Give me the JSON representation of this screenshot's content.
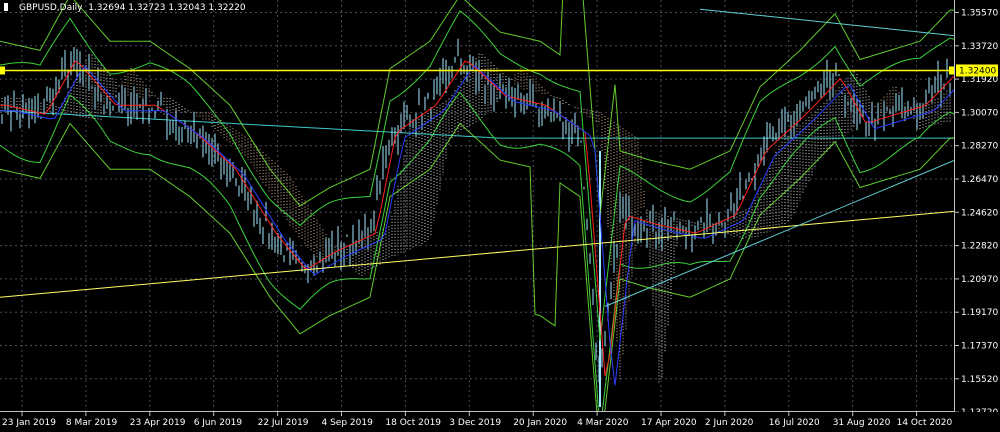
{
  "header": {
    "symbol": "GBPUSD,Daily",
    "ohlc": "1.32694 1.32723 1.32043 1.32220"
  },
  "price_scale": {
    "levels": [
      "1.35570",
      "1.33720",
      "1.31920",
      "1.30070",
      "1.28270",
      "1.26470",
      "1.24620",
      "1.22820",
      "1.20970",
      "1.19170",
      "1.17370",
      "1.15520",
      "1.13720"
    ],
    "current_price": "1.32400",
    "range": [
      1.1372,
      1.3557
    ]
  },
  "time_scale": {
    "labels": [
      "23 Jan 2019",
      "8 Mar 2019",
      "23 Apr 2019",
      "6 Jun 2019",
      "22 Jul 2019",
      "4 Sep 2019",
      "18 Oct 2019",
      "3 Dec 2019",
      "20 Jan 2020",
      "4 Mar 2020",
      "17 Apr 2020",
      "2 Jun 2020",
      "16 Jul 2020",
      "31 Aug 2020",
      "14 Oct 2020"
    ]
  },
  "colors": {
    "background": "#000000",
    "grid": "#4a4f5c",
    "axis": "#c0c0c0",
    "candle": "#9fe8ff",
    "horizontal_line": "#ffff00",
    "trend_line": "#ffff66",
    "channel_line": "#5ecfd4",
    "bollinger": "#3cd23c",
    "bollinger_outer": "#7cfc3a",
    "tenkan": "#ff2020",
    "kijun": "#2a3cff",
    "cloud_bull": "#ffd8b0",
    "cloud_bear": "#ffffff",
    "ma_slow": "#40c8c8"
  }
}
